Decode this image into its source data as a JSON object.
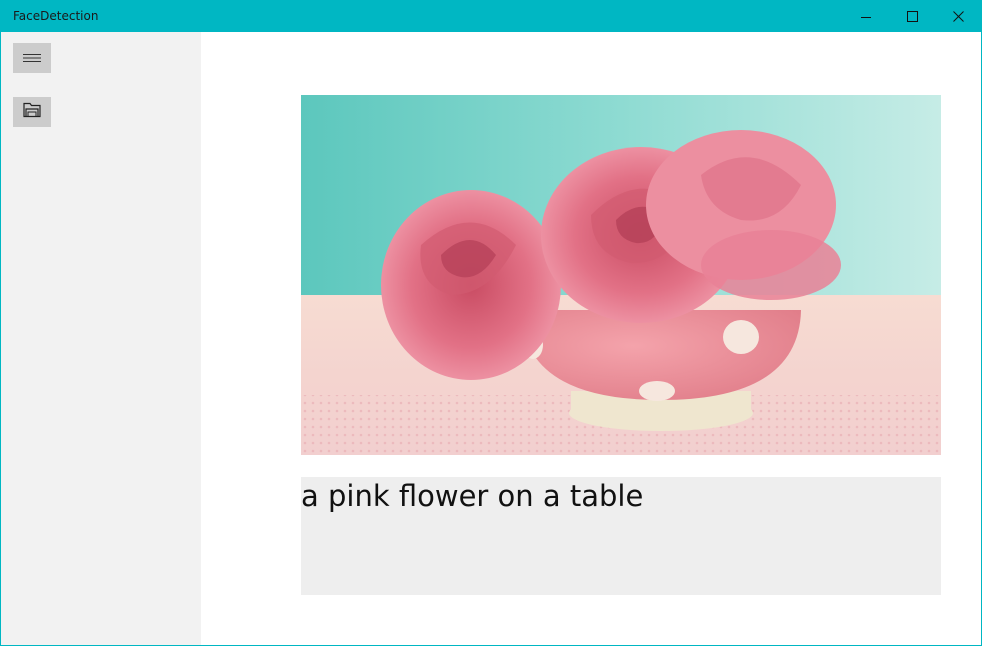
{
  "window": {
    "title": "FaceDetection",
    "accent_color": "#00b7c3",
    "controls": [
      "minimize-icon",
      "maximize-icon",
      "close-icon"
    ]
  },
  "sidebar": {
    "background": "#f2f2f2",
    "buttons": [
      {
        "icon": "hamburger-menu-icon"
      },
      {
        "icon": "open-photo-icon"
      }
    ]
  },
  "main": {
    "image": {
      "subject": "pink-roses-in-polka-dot-cup"
    },
    "caption": "a pink flower on a table"
  }
}
